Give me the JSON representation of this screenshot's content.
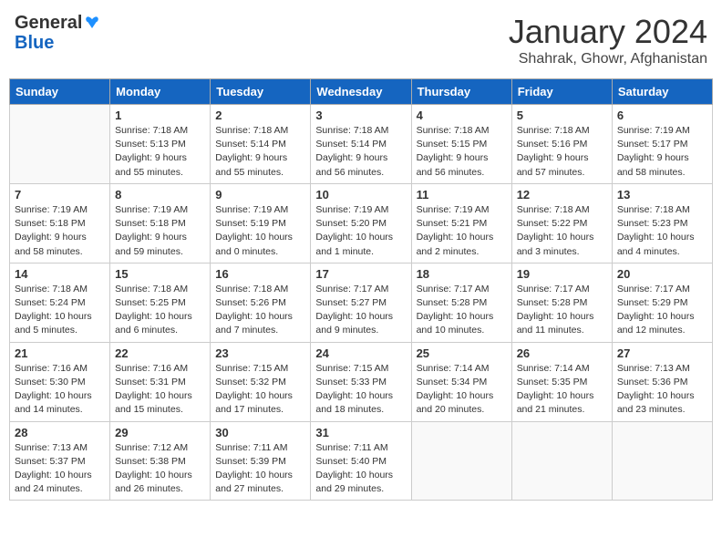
{
  "header": {
    "logo_general": "General",
    "logo_blue": "Blue",
    "month_year": "January 2024",
    "location": "Shahrak, Ghowr, Afghanistan"
  },
  "days_of_week": [
    "Sunday",
    "Monday",
    "Tuesday",
    "Wednesday",
    "Thursday",
    "Friday",
    "Saturday"
  ],
  "weeks": [
    [
      {
        "day": "",
        "info": ""
      },
      {
        "day": "1",
        "info": "Sunrise: 7:18 AM\nSunset: 5:13 PM\nDaylight: 9 hours and 55 minutes."
      },
      {
        "day": "2",
        "info": "Sunrise: 7:18 AM\nSunset: 5:14 PM\nDaylight: 9 hours and 55 minutes."
      },
      {
        "day": "3",
        "info": "Sunrise: 7:18 AM\nSunset: 5:14 PM\nDaylight: 9 hours and 56 minutes."
      },
      {
        "day": "4",
        "info": "Sunrise: 7:18 AM\nSunset: 5:15 PM\nDaylight: 9 hours and 56 minutes."
      },
      {
        "day": "5",
        "info": "Sunrise: 7:18 AM\nSunset: 5:16 PM\nDaylight: 9 hours and 57 minutes."
      },
      {
        "day": "6",
        "info": "Sunrise: 7:19 AM\nSunset: 5:17 PM\nDaylight: 9 hours and 58 minutes."
      }
    ],
    [
      {
        "day": "7",
        "info": "Sunrise: 7:19 AM\nSunset: 5:18 PM\nDaylight: 9 hours and 58 minutes."
      },
      {
        "day": "8",
        "info": "Sunrise: 7:19 AM\nSunset: 5:18 PM\nDaylight: 9 hours and 59 minutes."
      },
      {
        "day": "9",
        "info": "Sunrise: 7:19 AM\nSunset: 5:19 PM\nDaylight: 10 hours and 0 minutes."
      },
      {
        "day": "10",
        "info": "Sunrise: 7:19 AM\nSunset: 5:20 PM\nDaylight: 10 hours and 1 minute."
      },
      {
        "day": "11",
        "info": "Sunrise: 7:19 AM\nSunset: 5:21 PM\nDaylight: 10 hours and 2 minutes."
      },
      {
        "day": "12",
        "info": "Sunrise: 7:18 AM\nSunset: 5:22 PM\nDaylight: 10 hours and 3 minutes."
      },
      {
        "day": "13",
        "info": "Sunrise: 7:18 AM\nSunset: 5:23 PM\nDaylight: 10 hours and 4 minutes."
      }
    ],
    [
      {
        "day": "14",
        "info": "Sunrise: 7:18 AM\nSunset: 5:24 PM\nDaylight: 10 hours and 5 minutes."
      },
      {
        "day": "15",
        "info": "Sunrise: 7:18 AM\nSunset: 5:25 PM\nDaylight: 10 hours and 6 minutes."
      },
      {
        "day": "16",
        "info": "Sunrise: 7:18 AM\nSunset: 5:26 PM\nDaylight: 10 hours and 7 minutes."
      },
      {
        "day": "17",
        "info": "Sunrise: 7:17 AM\nSunset: 5:27 PM\nDaylight: 10 hours and 9 minutes."
      },
      {
        "day": "18",
        "info": "Sunrise: 7:17 AM\nSunset: 5:28 PM\nDaylight: 10 hours and 10 minutes."
      },
      {
        "day": "19",
        "info": "Sunrise: 7:17 AM\nSunset: 5:28 PM\nDaylight: 10 hours and 11 minutes."
      },
      {
        "day": "20",
        "info": "Sunrise: 7:17 AM\nSunset: 5:29 PM\nDaylight: 10 hours and 12 minutes."
      }
    ],
    [
      {
        "day": "21",
        "info": "Sunrise: 7:16 AM\nSunset: 5:30 PM\nDaylight: 10 hours and 14 minutes."
      },
      {
        "day": "22",
        "info": "Sunrise: 7:16 AM\nSunset: 5:31 PM\nDaylight: 10 hours and 15 minutes."
      },
      {
        "day": "23",
        "info": "Sunrise: 7:15 AM\nSunset: 5:32 PM\nDaylight: 10 hours and 17 minutes."
      },
      {
        "day": "24",
        "info": "Sunrise: 7:15 AM\nSunset: 5:33 PM\nDaylight: 10 hours and 18 minutes."
      },
      {
        "day": "25",
        "info": "Sunrise: 7:14 AM\nSunset: 5:34 PM\nDaylight: 10 hours and 20 minutes."
      },
      {
        "day": "26",
        "info": "Sunrise: 7:14 AM\nSunset: 5:35 PM\nDaylight: 10 hours and 21 minutes."
      },
      {
        "day": "27",
        "info": "Sunrise: 7:13 AM\nSunset: 5:36 PM\nDaylight: 10 hours and 23 minutes."
      }
    ],
    [
      {
        "day": "28",
        "info": "Sunrise: 7:13 AM\nSunset: 5:37 PM\nDaylight: 10 hours and 24 minutes."
      },
      {
        "day": "29",
        "info": "Sunrise: 7:12 AM\nSunset: 5:38 PM\nDaylight: 10 hours and 26 minutes."
      },
      {
        "day": "30",
        "info": "Sunrise: 7:11 AM\nSunset: 5:39 PM\nDaylight: 10 hours and 27 minutes."
      },
      {
        "day": "31",
        "info": "Sunrise: 7:11 AM\nSunset: 5:40 PM\nDaylight: 10 hours and 29 minutes."
      },
      {
        "day": "",
        "info": ""
      },
      {
        "day": "",
        "info": ""
      },
      {
        "day": "",
        "info": ""
      }
    ]
  ]
}
